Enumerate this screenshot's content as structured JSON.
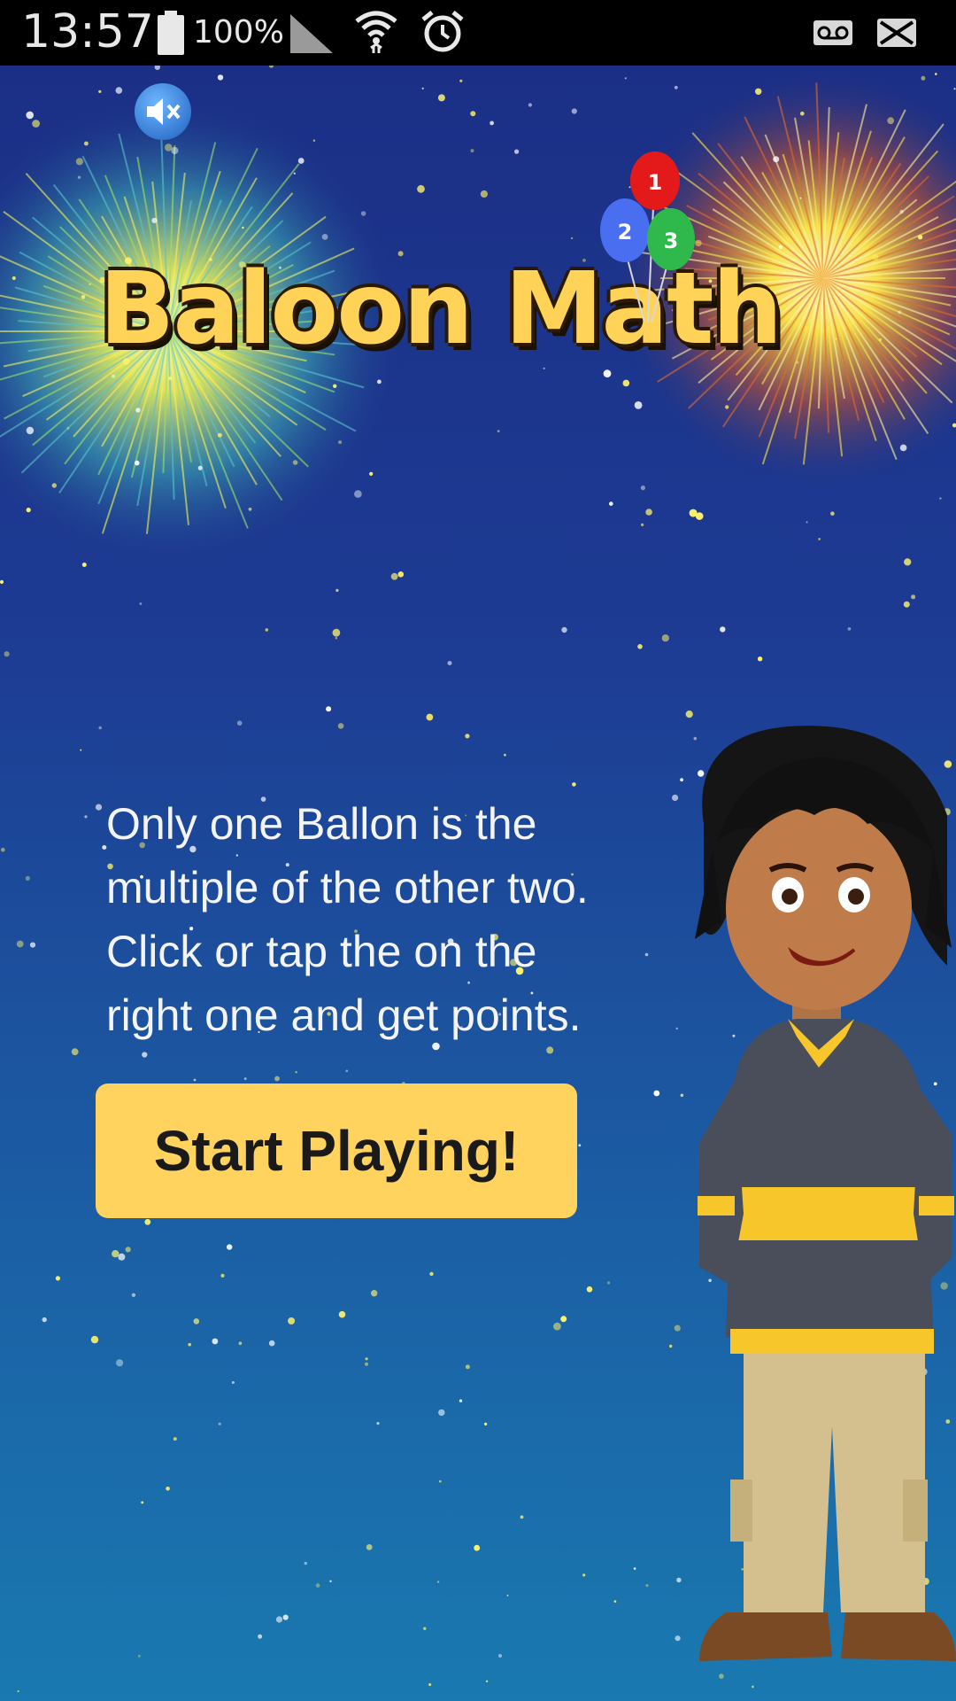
{
  "status_bar": {
    "time": "13:57",
    "battery_percent": "100%",
    "icons": [
      "battery-icon",
      "signal-icon",
      "wifi-icon",
      "alarm-icon",
      "voicemail-icon",
      "missed-message-icon"
    ]
  },
  "game": {
    "title": "Baloon Math",
    "balloons": [
      {
        "number": "1",
        "color": "#e41a1a"
      },
      {
        "number": "2",
        "color": "#4a6ef0"
      },
      {
        "number": "3",
        "color": "#2fb94d"
      }
    ],
    "instructions": [
      "Only one Ballon is the",
      "multiple of the other two.",
      "Click or tap the on the",
      "right one and get points."
    ],
    "start_button_label": "Start Playing!",
    "mute_icon": "speaker-mute-icon"
  },
  "colors": {
    "title": "#ffd258",
    "button": "#ffd35e",
    "sky_top": "#1b2f86",
    "sky_bottom": "#1a79b0"
  }
}
